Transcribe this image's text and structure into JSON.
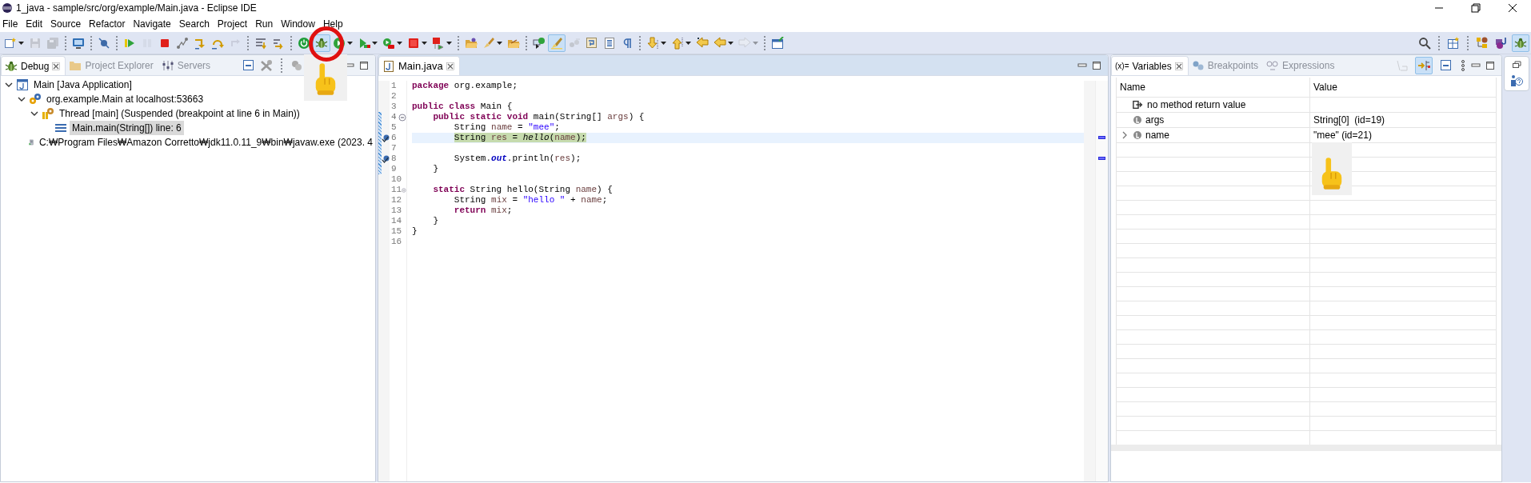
{
  "window": {
    "title": "1_java - sample/src/org/example/Main.java - Eclipse IDE"
  },
  "menu": [
    "File",
    "Edit",
    "Source",
    "Refactor",
    "Navigate",
    "Search",
    "Project",
    "Run",
    "Window",
    "Help"
  ],
  "toolbar": [
    {
      "kind": "button",
      "dropdown": true,
      "disabled": false,
      "pressed": false
    },
    {
      "kind": "button",
      "dropdown": false,
      "disabled": true,
      "pressed": false
    },
    {
      "kind": "button",
      "dropdown": false,
      "disabled": true,
      "pressed": false
    },
    {
      "kind": "separator"
    },
    {
      "kind": "button",
      "dropdown": false,
      "disabled": false,
      "pressed": false
    },
    {
      "kind": "separator"
    },
    {
      "kind": "button",
      "dropdown": false,
      "disabled": false,
      "pressed": false
    },
    {
      "kind": "separator"
    },
    {
      "kind": "button",
      "dropdown": false,
      "disabled": false,
      "pressed": false
    },
    {
      "kind": "button",
      "dropdown": false,
      "disabled": true,
      "pressed": false
    },
    {
      "kind": "button",
      "dropdown": false,
      "disabled": false,
      "pressed": false
    },
    {
      "kind": "button",
      "dropdown": false,
      "disabled": false,
      "pressed": false
    },
    {
      "kind": "button",
      "dropdown": false,
      "disabled": false,
      "pressed": false
    },
    {
      "kind": "button",
      "dropdown": false,
      "disabled": false,
      "pressed": false
    },
    {
      "kind": "button",
      "dropdown": false,
      "disabled": true,
      "pressed": false
    },
    {
      "kind": "separator"
    },
    {
      "kind": "button",
      "dropdown": false,
      "disabled": false,
      "pressed": false
    },
    {
      "kind": "button",
      "dropdown": false,
      "disabled": false,
      "pressed": false
    },
    {
      "kind": "separator"
    },
    {
      "kind": "button",
      "dropdown": false,
      "disabled": false,
      "pressed": false
    },
    {
      "kind": "button",
      "dropdown": false,
      "disabled": false,
      "pressed": true
    },
    {
      "kind": "button",
      "dropdown": true,
      "disabled": false,
      "pressed": false
    },
    {
      "kind": "button",
      "dropdown": true,
      "disabled": false,
      "pressed": false
    },
    {
      "kind": "button",
      "dropdown": true,
      "disabled": false,
      "pressed": false
    },
    {
      "kind": "button",
      "dropdown": true,
      "disabled": false,
      "pressed": false
    },
    {
      "kind": "button",
      "dropdown": true,
      "disabled": false,
      "pressed": false
    },
    {
      "kind": "separator"
    },
    {
      "kind": "button",
      "dropdown": false,
      "disabled": false,
      "pressed": false
    },
    {
      "kind": "button",
      "dropdown": true,
      "disabled": false,
      "pressed": false
    },
    {
      "kind": "button",
      "dropdown": false,
      "disabled": false,
      "pressed": false
    },
    {
      "kind": "separator"
    },
    {
      "kind": "button",
      "dropdown": false,
      "disabled": false,
      "pressed": false
    },
    {
      "kind": "button",
      "dropdown": false,
      "disabled": false,
      "pressed": true
    },
    {
      "kind": "button",
      "dropdown": false,
      "disabled": true,
      "pressed": false
    },
    {
      "kind": "button",
      "dropdown": false,
      "disabled": false,
      "pressed": false
    },
    {
      "kind": "button",
      "dropdown": false,
      "disabled": false,
      "pressed": false
    },
    {
      "kind": "button",
      "dropdown": false,
      "disabled": false,
      "pressed": false
    },
    {
      "kind": "separator"
    },
    {
      "kind": "button",
      "dropdown": true,
      "disabled": false,
      "pressed": false
    },
    {
      "kind": "button",
      "dropdown": true,
      "disabled": false,
      "pressed": false
    },
    {
      "kind": "button",
      "dropdown": false,
      "disabled": false,
      "pressed": false
    },
    {
      "kind": "button",
      "dropdown": true,
      "disabled": false,
      "pressed": false
    },
    {
      "kind": "button",
      "dropdown": true,
      "disabled": true,
      "pressed": false
    },
    {
      "kind": "separator"
    },
    {
      "kind": "button",
      "dropdown": false,
      "disabled": false,
      "pressed": false
    }
  ],
  "perspectives": [
    {
      "selected": false
    },
    {
      "selected": false
    },
    {
      "selected": true
    }
  ],
  "debug_view": {
    "tabs": [
      {
        "label": "Debug",
        "selected": true
      },
      {
        "label": "Project Explorer",
        "selected": false
      },
      {
        "label": "Servers",
        "selected": false
      }
    ],
    "tree": [
      {
        "kind": "launch",
        "label": "Main [Java Application]",
        "expanded": true,
        "selected": false,
        "children": [
          {
            "kind": "vm",
            "label": "org.example.Main at localhost:53663",
            "expanded": true,
            "selected": false,
            "children": [
              {
                "kind": "thread",
                "label": "Thread [main] (Suspended (breakpoint at line 6 in Main))",
                "expanded": true,
                "selected": false,
                "children": [
                  {
                    "kind": "frame",
                    "label": "Main.main(String[]) line: 6",
                    "selected": true
                  }
                ]
              }
            ]
          },
          {
            "kind": "process",
            "label": "C:₩Program Files₩Amazon Corretto₩jdk11.0.11_9₩bin₩javaw.exe (2023. 4",
            "selected": false
          }
        ]
      }
    ]
  },
  "editor": {
    "tabs": [
      {
        "label": "Main.java",
        "selected": true
      }
    ],
    "lines": [
      {
        "number": "1",
        "tokens": [
          {
            "kind": "keyword",
            "text": "package"
          },
          {
            "kind": "plain",
            "text": " org.example;"
          }
        ]
      },
      {
        "number": "2"
      },
      {
        "number": "3",
        "tokens": [
          {
            "kind": "keyword",
            "text": "public class"
          },
          {
            "kind": "plain",
            "text": " Main {"
          }
        ]
      },
      {
        "number": "4",
        "folded": false,
        "range": true,
        "tokens": [
          {
            "kind": "keyword",
            "text": "    public static void"
          },
          {
            "kind": "plain",
            "text": " main(String[] "
          },
          {
            "kind": "local",
            "text": "args"
          },
          {
            "kind": "plain",
            "text": ") {"
          }
        ]
      },
      {
        "number": "5",
        "range": true,
        "tokens": [
          {
            "kind": "plain",
            "text": "        String "
          },
          {
            "kind": "local",
            "text": "name"
          },
          {
            "kind": "plain",
            "text": " = "
          },
          {
            "kind": "string",
            "text": "\"mee\""
          },
          {
            "kind": "plain",
            "text": ";"
          }
        ]
      },
      {
        "number": "6",
        "range": true,
        "current": true,
        "instruction_pointer": true,
        "breakpoint": true,
        "ruler_mark": true,
        "tokens": [
          {
            "kind": "plain",
            "text": "        String "
          },
          {
            "kind": "local",
            "text": "res"
          },
          {
            "kind": "plain",
            "text": " = "
          },
          {
            "kind": "static_method",
            "text": "hello"
          },
          {
            "kind": "plain",
            "text": "("
          },
          {
            "kind": "local",
            "text": "name"
          },
          {
            "kind": "plain",
            "text": ");"
          }
        ]
      },
      {
        "number": "7",
        "range": true
      },
      {
        "number": "8",
        "range": true,
        "breakpoint": true,
        "ruler_mark": true,
        "tokens": [
          {
            "kind": "plain",
            "text": "        System."
          },
          {
            "kind": "field",
            "text": "out"
          },
          {
            "kind": "plain",
            "text": ".println("
          },
          {
            "kind": "local",
            "text": "res"
          },
          {
            "kind": "plain",
            "text": ");"
          }
        ]
      },
      {
        "number": "9",
        "range": true,
        "tokens": [
          {
            "kind": "plain",
            "text": "    }"
          }
        ]
      },
      {
        "number": "10"
      },
      {
        "number": "11",
        "folded": false,
        "tokens": [
          {
            "kind": "keyword",
            "text": "    static"
          },
          {
            "kind": "plain",
            "text": " String hello(String "
          },
          {
            "kind": "local",
            "text": "name"
          },
          {
            "kind": "plain",
            "text": ") {"
          }
        ]
      },
      {
        "number": "12",
        "tokens": [
          {
            "kind": "plain",
            "text": "        String "
          },
          {
            "kind": "local",
            "text": "mix"
          },
          {
            "kind": "plain",
            "text": " = "
          },
          {
            "kind": "string",
            "text": "\"hello \""
          },
          {
            "kind": "plain",
            "text": " + "
          },
          {
            "kind": "local",
            "text": "name"
          },
          {
            "kind": "plain",
            "text": ";"
          }
        ]
      },
      {
        "number": "13",
        "tokens": [
          {
            "kind": "keyword",
            "text": "        return"
          },
          {
            "kind": "local",
            "text": " mix"
          },
          {
            "kind": "plain",
            "text": ";"
          }
        ]
      },
      {
        "number": "14",
        "tokens": [
          {
            "kind": "plain",
            "text": "    }"
          }
        ]
      },
      {
        "number": "15",
        "tokens": [
          {
            "kind": "plain",
            "text": "}"
          }
        ]
      },
      {
        "number": "16"
      }
    ]
  },
  "variables_view": {
    "tabs": [
      {
        "label": "Variables",
        "prefix": "(x)=",
        "selected": true
      },
      {
        "label": "Breakpoints",
        "selected": false
      },
      {
        "label": "Expressions",
        "selected": false
      }
    ],
    "view_toolbar": [
      {
        "pressed": false,
        "disabled": true
      },
      {
        "pressed": true,
        "disabled": false
      },
      {
        "pressed": false,
        "disabled": false
      }
    ],
    "columns": [
      "Name",
      "Value"
    ],
    "rows": [
      {
        "kind": "return",
        "name": "no method return value",
        "selected": false
      },
      {
        "kind": "local",
        "name": "args",
        "value": "String[0]  (id=19)",
        "selected": false
      },
      {
        "kind": "local",
        "name": "name",
        "value": "\"mee\" (id=21)",
        "expandable": true,
        "expanded": false,
        "selected": false
      }
    ]
  }
}
